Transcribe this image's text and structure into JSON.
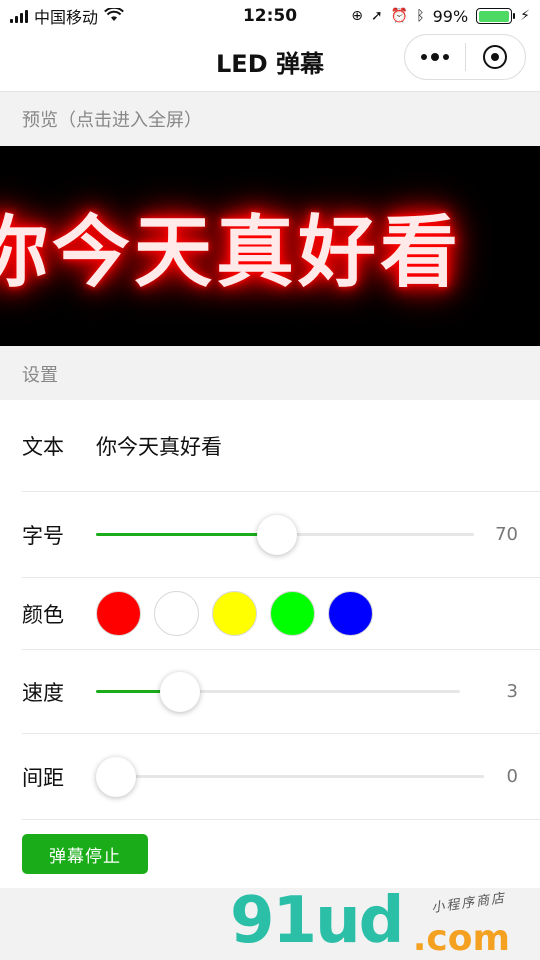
{
  "status_bar": {
    "carrier": "中国移动",
    "time": "12:50",
    "battery": "99%",
    "battery_level": 0.99
  },
  "nav": {
    "title": "LED 弹幕"
  },
  "preview": {
    "header": "预览（点击进入全屏）",
    "text": "你今天真好看",
    "color": "#ff0000"
  },
  "settings": {
    "header": "设置",
    "text_label": "文本",
    "text_value": "你今天真好看",
    "size_label": "字号",
    "size_value": "70",
    "size_fraction": 0.48,
    "color_label": "颜色",
    "colors": [
      "#ff0000",
      "#ffffff",
      "#ffff00",
      "#00ff00",
      "#0000ff"
    ],
    "selected_color": "#ff0000",
    "speed_label": "速度",
    "speed_value": "3",
    "speed_fraction": 0.23,
    "spacing_label": "间距",
    "spacing_value": "0",
    "spacing_fraction": 0,
    "stop_button": "弹幕停止"
  },
  "watermark": {
    "main": "91ud",
    "com": ".com",
    "sub": "小程序商店"
  }
}
